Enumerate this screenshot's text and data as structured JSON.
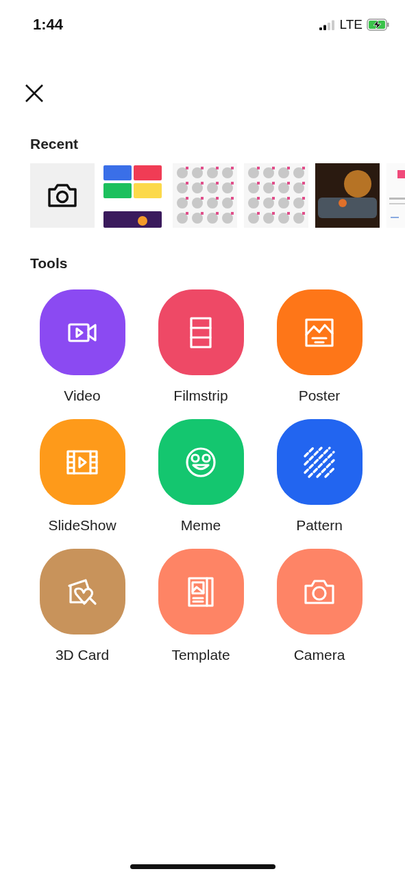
{
  "status_bar": {
    "time": "1:44",
    "network": "LTE",
    "charging": true
  },
  "recent": {
    "title": "Recent",
    "items": [
      {
        "kind": "camera"
      },
      {
        "kind": "tools"
      },
      {
        "kind": "shapes"
      },
      {
        "kind": "shapes"
      },
      {
        "kind": "photo"
      },
      {
        "kind": "document"
      }
    ]
  },
  "tools": {
    "title": "Tools",
    "items": [
      {
        "label": "Video",
        "kind": "video",
        "color": "#8b4af2"
      },
      {
        "label": "Filmstrip",
        "kind": "filmstrip",
        "color": "#ee4966"
      },
      {
        "label": "Poster",
        "kind": "poster",
        "color": "#fe7618"
      },
      {
        "label": "SlideShow",
        "kind": "slideshow",
        "color": "#fe9a1a"
      },
      {
        "label": "Meme",
        "kind": "meme",
        "color": "#14c66f"
      },
      {
        "label": "Pattern",
        "kind": "pattern",
        "color": "#2265f0"
      },
      {
        "label": "3D Card",
        "kind": "card",
        "color": "#c8935b"
      },
      {
        "label": "Template",
        "kind": "template",
        "color": "#fe8465"
      },
      {
        "label": "Camera",
        "kind": "camera",
        "color": "#fe8466"
      }
    ]
  }
}
